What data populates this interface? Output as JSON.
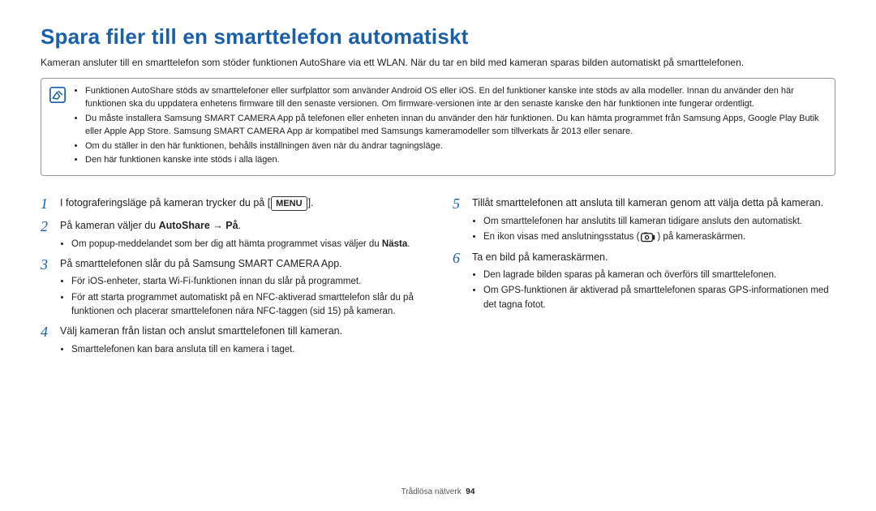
{
  "title": "Spara filer till en smarttelefon automatiskt",
  "intro": "Kameran ansluter till en smarttelefon som stöder funktionen AutoShare via ett WLAN. När du tar en bild med kameran sparas bilden automatiskt på smarttelefonen.",
  "note": {
    "items": [
      "Funktionen AutoShare stöds av smarttelefoner eller surfplattor som använder Android OS eller iOS. En del funktioner kanske inte stöds av alla modeller. Innan du använder den här funktionen ska du uppdatera enhetens firmware till den senaste versionen. Om firmware-versionen inte är den senaste kanske den här funktionen inte fungerar ordentligt.",
      "Du måste installera Samsung SMART CAMERA App på telefonen eller enheten innan du använder den här funktionen. Du kan hämta programmet från Samsung Apps, Google Play Butik eller Apple App Store. Samsung SMART CAMERA App är kompatibel med Samsungs kameramodeller som tillverkats år 2013 eller senare.",
      "Om du ställer in den här funktionen, behålls inställningen även när du ändrar tagningsläge.",
      "Den här funktionen kanske inte stöds i alla lägen."
    ]
  },
  "steps": {
    "s1_pre": "I fotograferingsläge på kameran trycker du på [",
    "s1_menu": "MENU",
    "s1_post": "].",
    "s2_pre": "På kameran väljer du ",
    "s2_bold": "AutoShare → På",
    "s2_post": ".",
    "s2_sub1_pre": "Om popup-meddelandet som ber dig att hämta programmet visas väljer du ",
    "s2_sub1_bold": "Nästa",
    "s2_sub1_post": ".",
    "s3": "På smarttelefonen slår du på Samsung SMART CAMERA App.",
    "s3_sub": [
      "För iOS-enheter, starta Wi-Fi-funktionen innan du slår på programmet.",
      "För att starta programmet automatiskt på en NFC-aktiverad smarttelefon slår du på funktionen och placerar smarttelefonen nära NFC-taggen (sid 15) på kameran."
    ],
    "s4": "Välj kameran från listan och anslut smarttelefonen till kameran.",
    "s4_sub": [
      "Smarttelefonen kan bara ansluta till en kamera i taget."
    ],
    "s5": "Tillåt smarttelefonen att ansluta till kameran genom att välja detta på kameran.",
    "s5_sub": [
      "Om smarttelefonen har anslutits till kameran tidigare ansluts den automatiskt."
    ],
    "s5_sub2_pre": "En ikon visas med anslutningsstatus (",
    "s5_sub2_post": ") på kameraskärmen.",
    "s6": "Ta en bild på kameraskärmen.",
    "s6_sub": [
      "Den lagrade bilden sparas på kameran och överförs till smarttelefonen.",
      "Om GPS-funktionen är aktiverad på smarttelefonen sparas GPS-informationen med det tagna fotot."
    ]
  },
  "footer": {
    "section": "Trådlösa nätverk",
    "page": "94"
  }
}
